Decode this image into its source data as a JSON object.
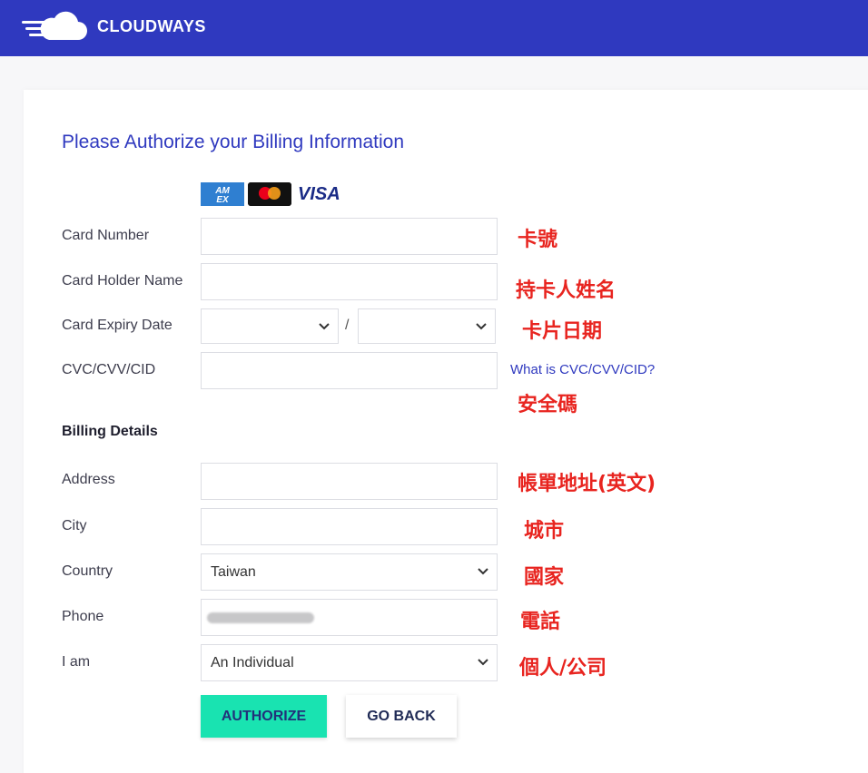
{
  "header": {
    "brand": "CLOUDWAYS",
    "bg_color": "#2f39bf",
    "logo_icon": "cloud-speed-icon"
  },
  "form": {
    "title": "Please Authorize your Billing Information",
    "card_brands": [
      "amex-icon",
      "mastercard-icon",
      "VISA"
    ],
    "visa_text": "VISA",
    "card_number_label": "Card Number",
    "card_holder_label": "Card Holder Name",
    "expiry_label": "Card Expiry Date",
    "expiry_separator": "/",
    "cvc_label": "CVC/CVV/CID",
    "cvc_help_link": "What is CVC/CVV/CID?",
    "billing_section": "Billing Details",
    "address_label": "Address",
    "city_label": "City",
    "country_label": "Country",
    "country_value": "Taiwan",
    "phone_label": "Phone",
    "iam_label": "I am",
    "iam_value": "An Individual",
    "authorize_button": "AUTHORIZE",
    "goback_button": "GO BACK",
    "accent_color": "#19e3b1"
  },
  "annotations": {
    "card_number": "卡號",
    "card_holder": "持卡人姓名",
    "expiry": "卡片日期",
    "cvc": "安全碼",
    "address": "帳單地址(英文)",
    "city": "城市",
    "country": "國家",
    "phone": "電話",
    "iam": "個人/公司",
    "color": "#e8241f"
  }
}
